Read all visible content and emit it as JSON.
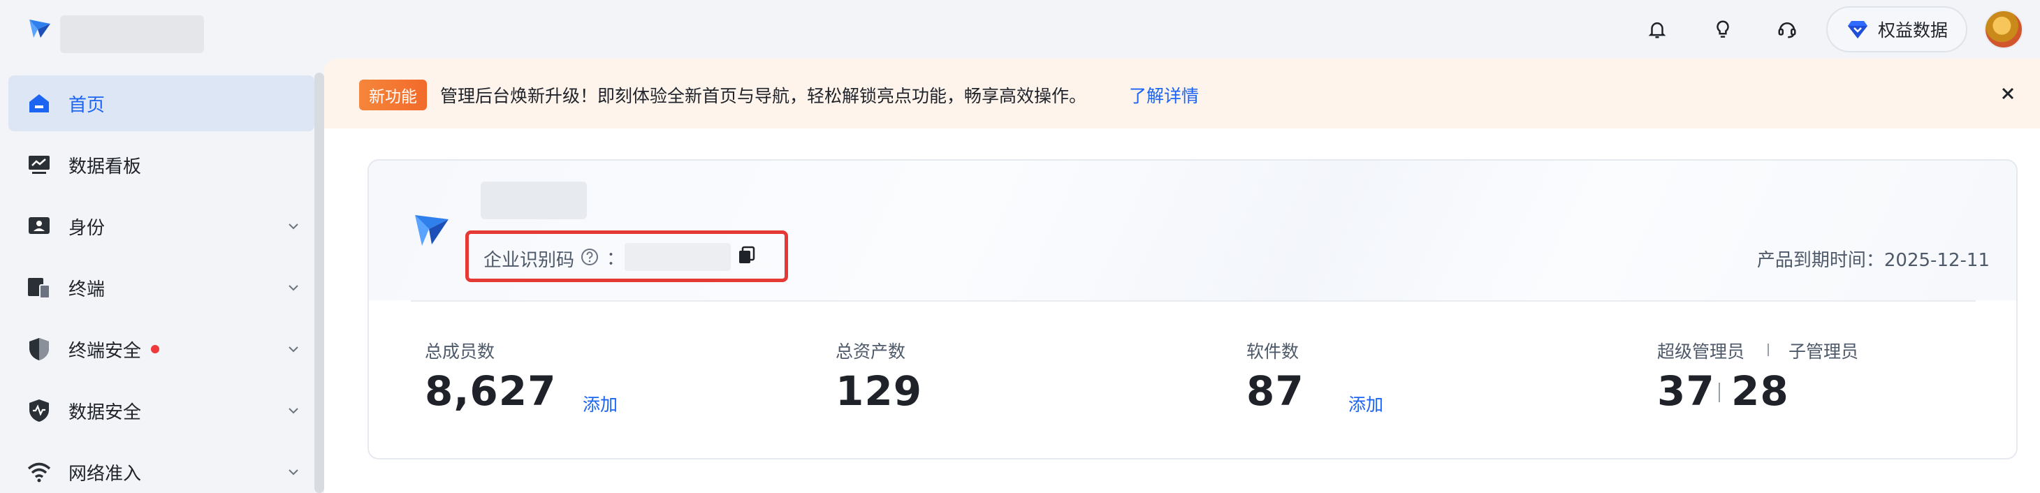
{
  "header": {
    "benefits_label": "权益数据",
    "accent": "#1c64f2"
  },
  "sidebar": {
    "items": [
      {
        "label": "首页",
        "icon": "home-icon",
        "active": true
      },
      {
        "label": "数据看板",
        "icon": "dashboard-icon"
      },
      {
        "label": "身份",
        "icon": "identity-icon"
      },
      {
        "label": "终端",
        "icon": "devices-icon"
      },
      {
        "label": "终端安全",
        "icon": "shield-icon",
        "badge_dot": true
      },
      {
        "label": "数据安全",
        "icon": "shield-pulse-icon"
      },
      {
        "label": "网络准入",
        "icon": "wifi-icon"
      }
    ]
  },
  "banner": {
    "badge": "新功能",
    "text": "管理后台焕新升级！即刻体验全新首页与导航，轻松解锁亮点功能，畅享高效操作。",
    "link": "了解详情"
  },
  "card": {
    "corp_code_label": "企业识别码",
    "colon": "：",
    "expiry": "产品到期时间：2025-12-11",
    "stats": {
      "members_label": "总成员数",
      "members_value": "8,627",
      "members_link": "添加",
      "assets_label": "总资产数",
      "assets_value": "129",
      "software_label": "软件数",
      "software_value": "87",
      "software_link": "添加",
      "super_admin_label": "超级管理员",
      "sub_admin_label": "子管理员",
      "super_admin_value": "37",
      "sub_admin_value": "28"
    }
  }
}
